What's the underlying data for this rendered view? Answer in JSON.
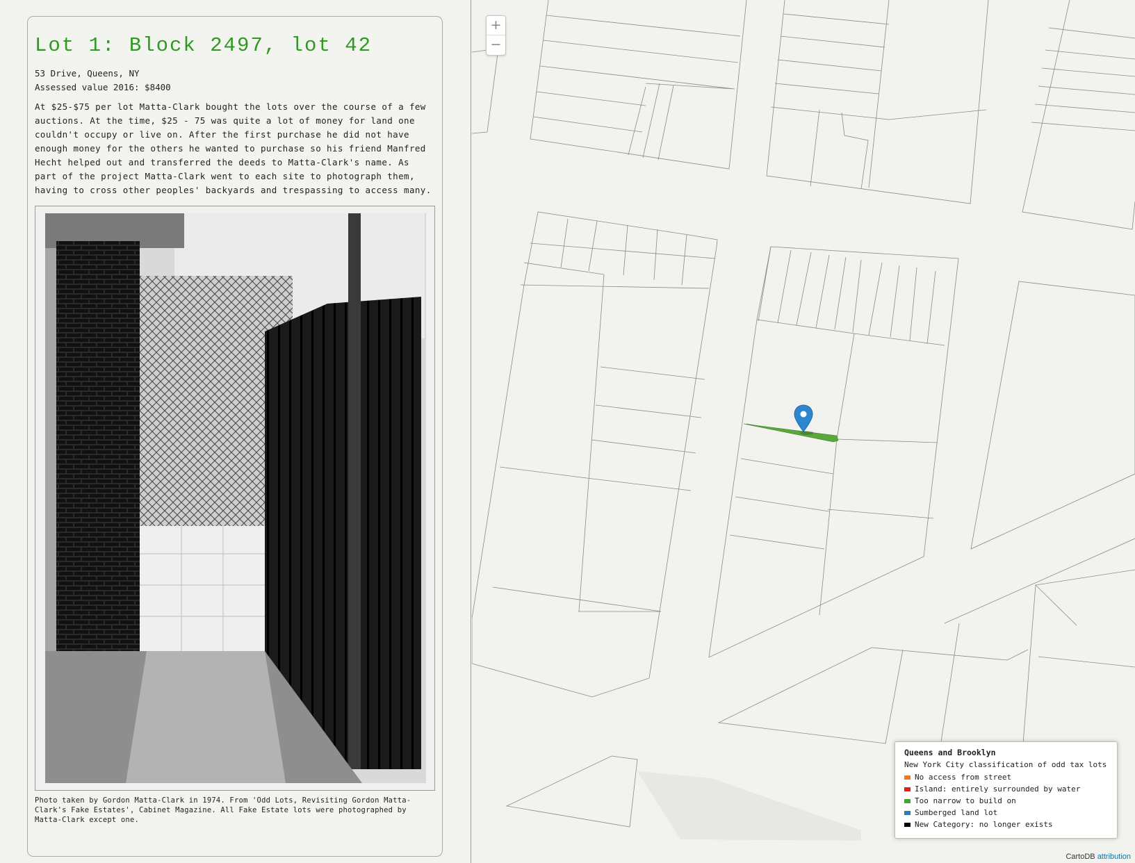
{
  "sidebar": {
    "lot_title": "Lot 1: Block 2497, lot 42",
    "address": "53 Drive, Queens, NY",
    "assessed_value": "Assessed value 2016: $8400",
    "description": "At $25-$75 per lot Matta-Clark bought the lots over the course of a few auctions. At the time, $25 - 75 was quite a lot of money for land one couldn't occupy or live on. After the first purchase he did not have enough money for the others he wanted to purchase so his friend Manfred Hecht helped out and transferred the deeds to Matta-Clark's name. As part of the project Matta-Clark went to each site to photograph them, having to cross other peoples' backyards and trespassing to access many.",
    "photo_caption": "Photo taken by Gordon Matta-Clark in 1974. From 'Odd Lots, Revisiting Gordon Matta-Clark's Fake Estates', Cabinet Magazine. All Fake Estate lots were photographed by Matta-Clark except one."
  },
  "map": {
    "zoom_in": "+",
    "zoom_out": "−",
    "highlight_color": "#5aa83c",
    "marker_color": "#2a87d0",
    "legend": {
      "title": "Queens and Brooklyn",
      "subtitle": "New York City classification of odd tax lots",
      "items": [
        {
          "label": "No access from street",
          "color": "#f07a1e"
        },
        {
          "label": "Island: entirely surrounded by water",
          "color": "#e02020"
        },
        {
          "label": "Too narrow to build on",
          "color": "#3aa82a"
        },
        {
          "label": "Sumberged land lot",
          "color": "#2f7ab8"
        },
        {
          "label": "New Category: no longer exists",
          "color": "#000000"
        }
      ]
    },
    "attribution_prefix": "CartoDB",
    "attribution_link": "attribution"
  }
}
